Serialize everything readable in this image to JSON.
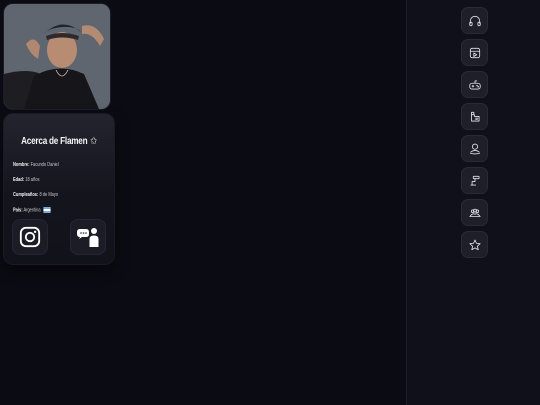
{
  "profile": {
    "photo_icon": "profile-photo",
    "about_title": "Acerca de Flamen",
    "about_title_icon": "star-icon",
    "fields": [
      {
        "label": "Nombre:",
        "value": "Facundo Daniel"
      },
      {
        "label": "Edad:",
        "value": "18 años"
      },
      {
        "label": "Cumpleaños:",
        "value": "8 de Mayo"
      },
      {
        "label": "País:",
        "value": "Argentina"
      }
    ],
    "country_flag": "argentina-flag",
    "social": [
      {
        "icon": "instagram-icon"
      },
      {
        "icon": "speech-bubble-person-icon"
      }
    ]
  },
  "sidebar": {
    "items": [
      {
        "icon": "headphones-icon"
      },
      {
        "icon": "video-icon"
      },
      {
        "icon": "gamepad-icon"
      },
      {
        "icon": "chat-icon"
      },
      {
        "icon": "support-icon"
      },
      {
        "icon": "stool-icon"
      },
      {
        "icon": "group-icon"
      },
      {
        "icon": "star-icon"
      }
    ]
  },
  "colors": {
    "background": "#0b0b13",
    "card": "#14141d",
    "sidebar": "#10101a",
    "button": "#1f1f2a",
    "flag_blue": "#75aadb"
  }
}
